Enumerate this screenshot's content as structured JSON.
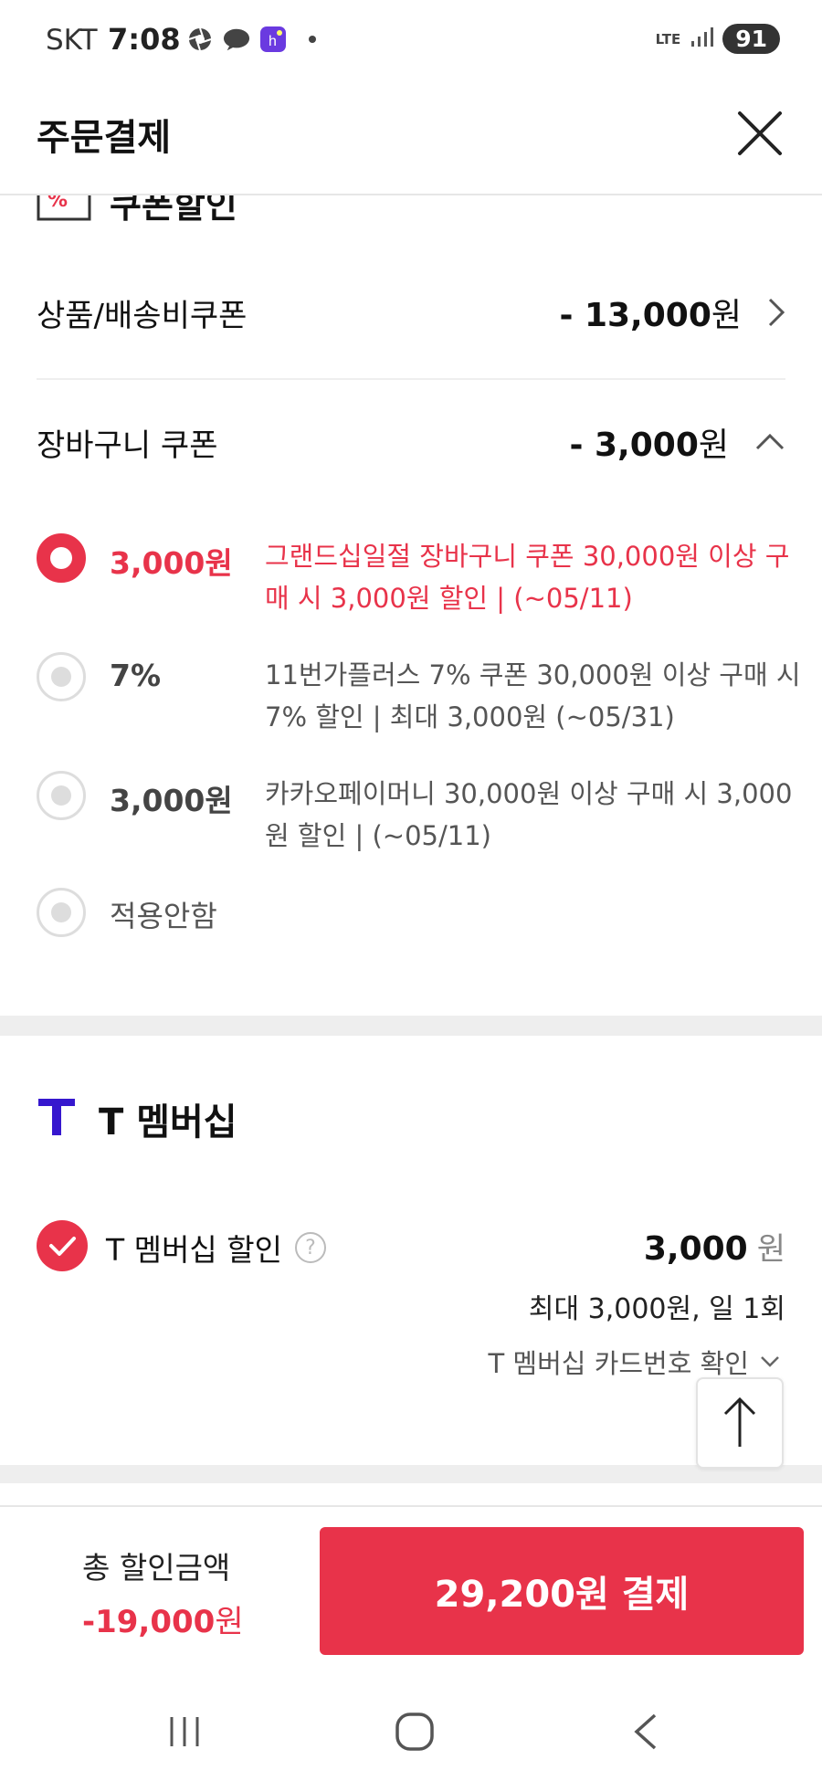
{
  "status_bar": {
    "carrier": "SKT",
    "time": "7:08",
    "network": "LTE",
    "battery": "91"
  },
  "header": {
    "title": "주문결제"
  },
  "coupon_section": {
    "title": "쿠폰할인",
    "product_shipping": {
      "label": "상품/배송비쿠폰",
      "amount": "- 13,000",
      "unit": "원"
    },
    "cart_coupon": {
      "label": "장바구니 쿠폰",
      "amount": "- 3,000",
      "unit": "원"
    },
    "options": [
      {
        "amount": "3,000원",
        "description": "그랜드십일절 장바구니 쿠폰 30,000원 이상 구매 시 3,000원 할인 | (~05/11)",
        "selected": true
      },
      {
        "amount": "7%",
        "description": "11번가플러스 7% 쿠폰 30,000원 이상 구매 시 7% 할인 | 최대 3,000원 (~05/31)",
        "selected": false
      },
      {
        "amount": "3,000원",
        "description": "카카오페이머니 30,000원 이상 구매 시 3,000원 할인 | (~05/11)",
        "selected": false
      }
    ],
    "none_option": "적용안함"
  },
  "t_membership": {
    "title": "T 멤버십",
    "discount_label": "T 멤버십 할인",
    "help_glyph": "?",
    "amount": "3,000",
    "unit": "원",
    "limit": "최대 3,000원, 일 1회",
    "card_check": "T 멤버십 카드번호 확인"
  },
  "footer": {
    "total_label": "총 할인금액",
    "total_value": "-19,000",
    "total_unit": "원",
    "pay_button": "29,200원 결제"
  },
  "colors": {
    "accent": "#e8334a",
    "t_brand": "#3617ce"
  }
}
